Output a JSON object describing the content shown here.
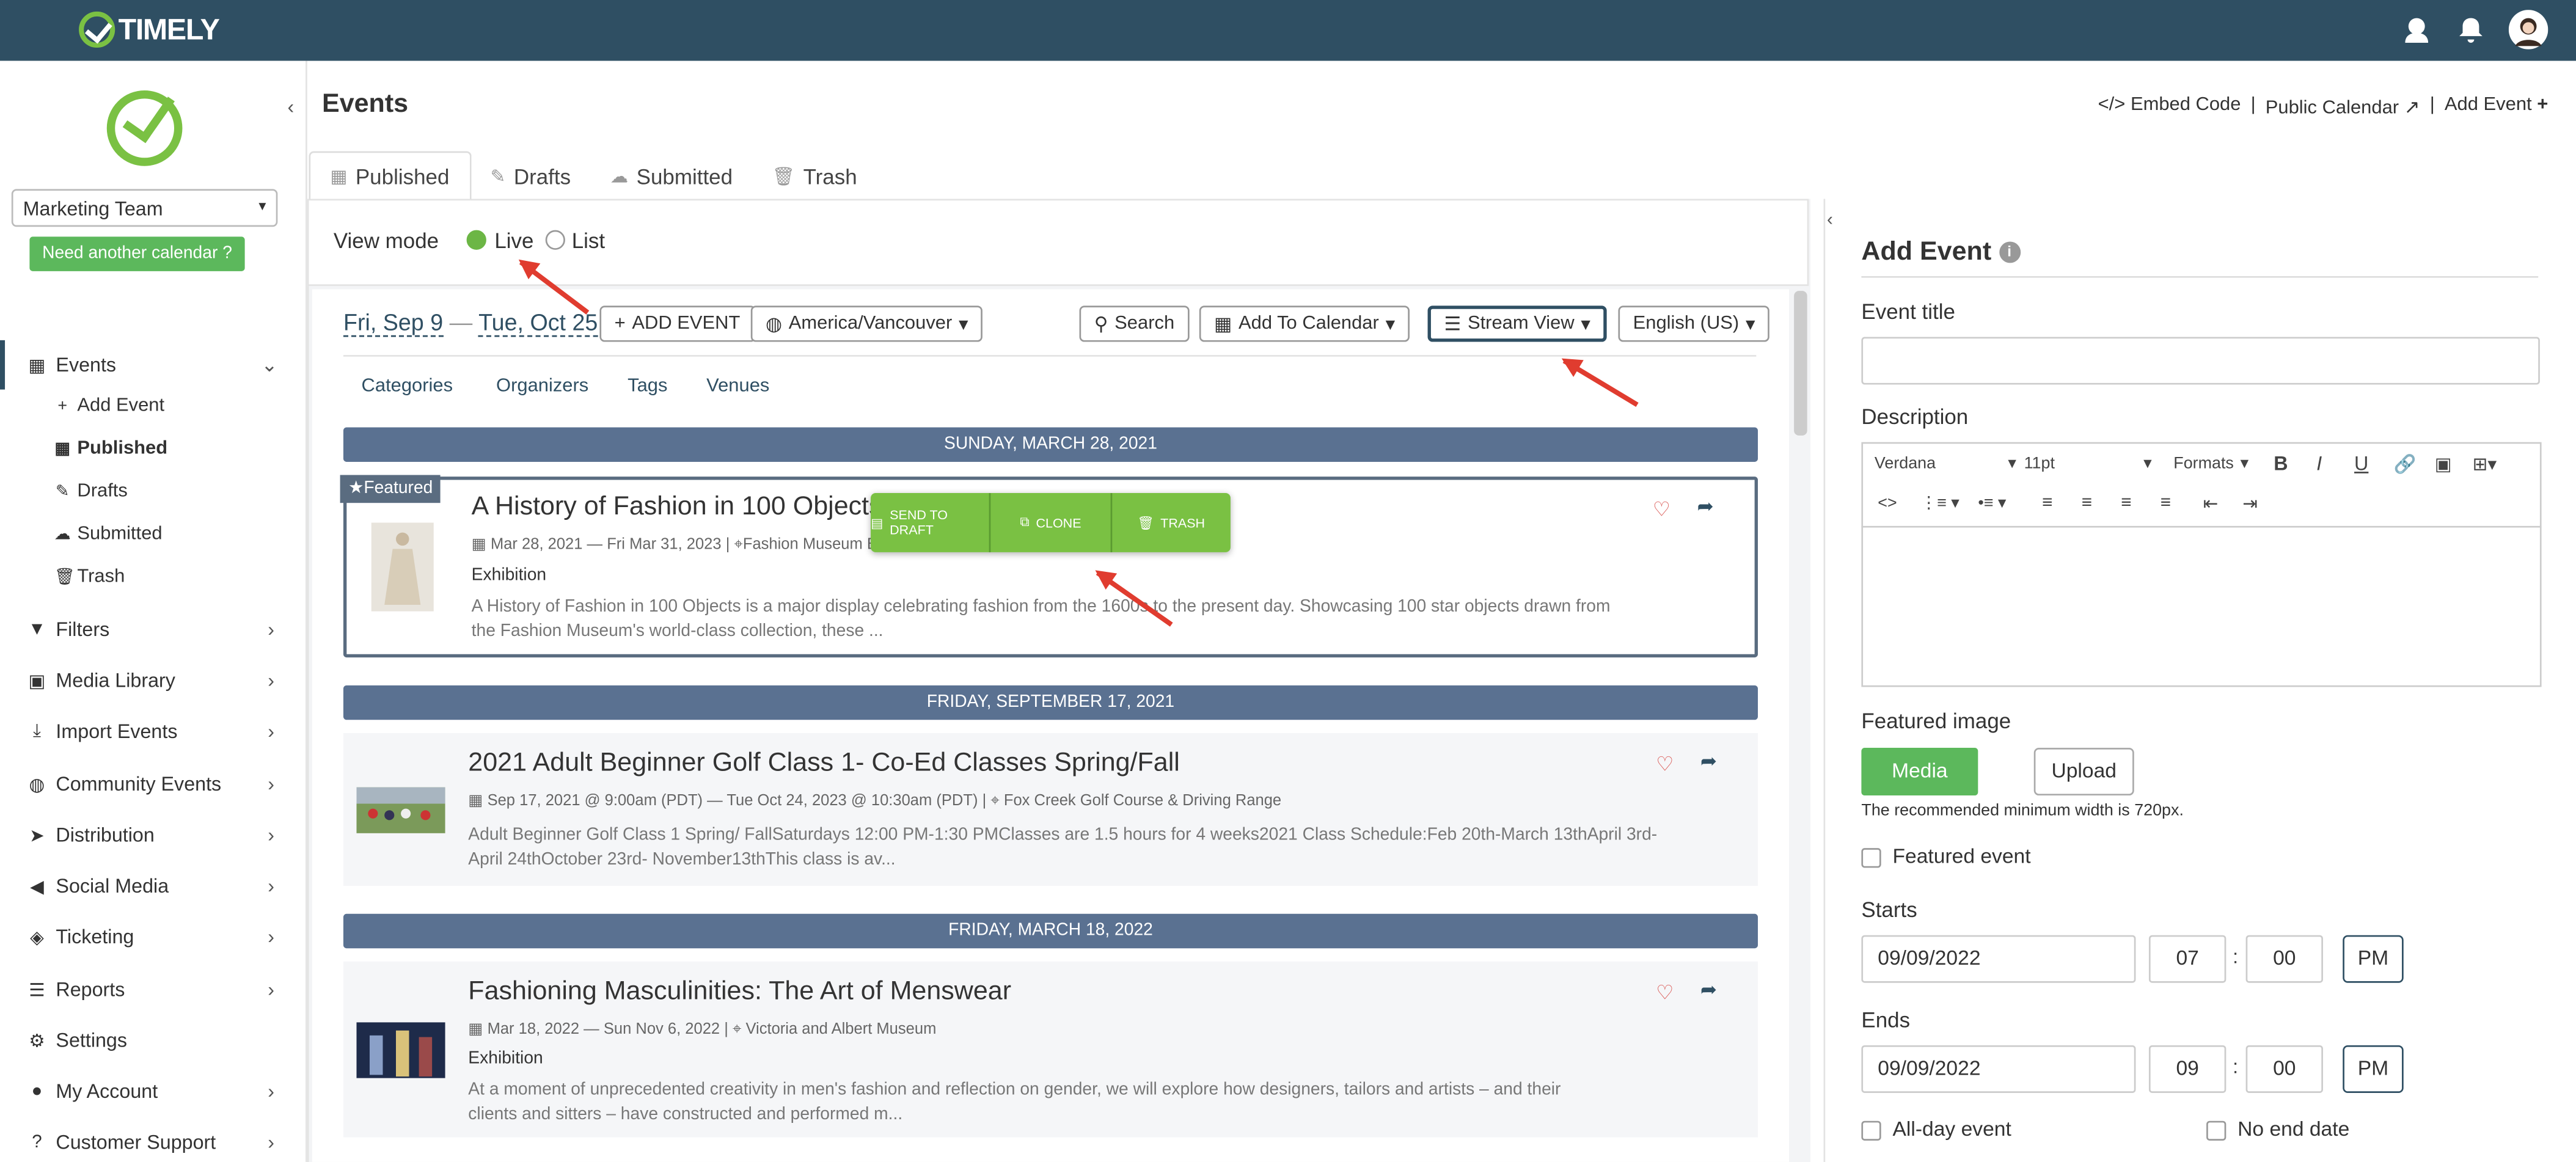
{
  "brand": {
    "name": "TIMELY"
  },
  "sidebar": {
    "calendar_select": "Marketing Team",
    "need_button": "Need another calendar",
    "events_label": "Events",
    "sub_items": [
      "Add Event",
      "Published",
      "Drafts",
      "Submitted",
      "Trash"
    ],
    "items": [
      "Filters",
      "Media Library",
      "Import Events",
      "Community Events",
      "Distribution",
      "Social Media",
      "Ticketing",
      "Reports",
      "Settings",
      "My Account",
      "Customer Support"
    ]
  },
  "header": {
    "title": "Events",
    "links": [
      "Embed Code",
      "Public Calendar",
      "Add Event"
    ]
  },
  "tabs": [
    "Published",
    "Drafts",
    "Submitted",
    "Trash"
  ],
  "view_mode": {
    "label": "View mode",
    "options": [
      "Live",
      "List"
    ],
    "selected": "Live"
  },
  "toolbar": {
    "date_from": "Fri, Sep 9",
    "date_sep": "—",
    "date_to": "Tue, Oct 25",
    "add_event": "ADD EVENT",
    "timezone": "America/Vancouver",
    "search": "Search",
    "add_to_calendar": "Add To Calendar",
    "view": "Stream View",
    "language": "English (US)"
  },
  "subnav": [
    "Categories",
    "Organizers",
    "Tags",
    "Venues"
  ],
  "events": [
    {
      "date_header": "SUNDAY, MARCH 28, 2021",
      "featured_tag": "Featured",
      "title": "A History of Fashion in 100 Objects",
      "meta_date": "Mar 28, 2021 — Fri Mar 31, 2023 |",
      "meta_venue": "Fashion Museum Bat",
      "category": "Exhibition",
      "description_1": "A History of Fashion in 100 Objects is a major display celebrating fashion from the 1600s to the present day. Showcasing 100 star objects drawn from",
      "description_2": "the Fashion Museum's world-class collection, these ..."
    },
    {
      "date_header": "FRIDAY, SEPTEMBER 17, 2021",
      "title": "2021 Adult Beginner Golf Class 1- Co-Ed Classes Spring/Fall",
      "meta_date": "Sep 17, 2021 @ 9:00am (PDT) — Tue Oct 24, 2023 @ 10:30am (PDT) |",
      "meta_venue": "Fox Creek Golf Course & Driving Range",
      "description_1": "Adult Beginner Golf Class 1 Spring/ FallSaturdays 12:00 PM-1:30 PMClasses are 1.5 hours for 4 weeks2021 Class Schedule:Feb 20th-March 13thApril 3rd-",
      "description_2": "April 24thOctober 23rd- November13thThis class is av..."
    },
    {
      "date_header": "FRIDAY, MARCH 18, 2022",
      "title": "Fashioning Masculinities: The Art of Menswear",
      "meta_date": "Mar 18, 2022 — Sun Nov 6, 2022 |",
      "meta_venue": "Victoria and Albert Museum",
      "category": "Exhibition",
      "description_1": "At a moment of unprecedented creativity in men's fashion and reflection on gender, we will explore how designers, tailors and artists – and their",
      "description_2": "clients and sitters – have constructed and performed m..."
    }
  ],
  "actions": [
    "SEND TO DRAFT",
    "CLONE",
    "TRASH"
  ],
  "add_event_panel": {
    "title": "Add Event",
    "event_title_label": "Event title",
    "event_title_value": "",
    "description_label": "Description",
    "font": "Verdana",
    "font_size": "11pt",
    "formats": "Formats",
    "featured_image_label": "Featured image",
    "media_library": "Media Library",
    "upload": "Upload",
    "hint": "The recommended minimum width is 720px.",
    "featured_event": "Featured event",
    "starts_label": "Starts",
    "start_date": "09/09/2022",
    "start_hour": "07",
    "start_min": "00",
    "start_ampm": "PM",
    "ends_label": "Ends",
    "end_date": "09/09/2022",
    "end_hour": "09",
    "end_min": "00",
    "end_ampm": "PM",
    "all_day": "All-day event",
    "no_end": "No end date",
    "colon": ":"
  },
  "colors": {
    "topbar": "#2f4f63",
    "brand_green": "#7ac143",
    "date_bar": "#5a7191",
    "annotation_arrow": "#e03c2f"
  }
}
